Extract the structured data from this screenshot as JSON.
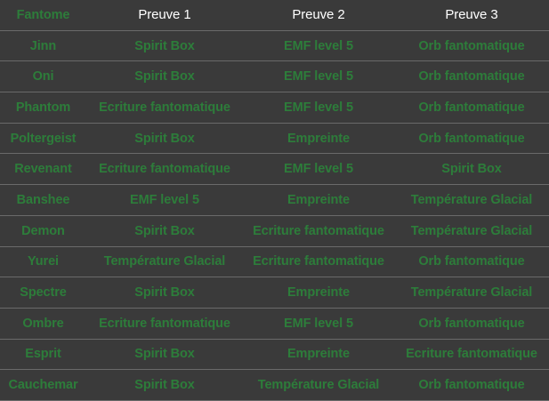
{
  "headers": [
    "Fantome",
    "Preuve   1",
    "Preuve   2",
    "Preuve   3"
  ],
  "rows": [
    [
      "Jinn",
      "Spirit Box",
      "EMF level 5",
      "Orb fantomatique"
    ],
    [
      "Oni",
      "Spirit Box",
      "EMF level 5",
      "Orb fantomatique"
    ],
    [
      "Phantom",
      "Ecriture fantomatique",
      "EMF level 5",
      "Orb fantomatique"
    ],
    [
      "Poltergeist",
      "Spirit Box",
      "Empreinte",
      "Orb fantomatique"
    ],
    [
      "Revenant",
      "Ecriture fantomatique",
      "EMF level 5",
      "Spirit Box"
    ],
    [
      "Banshee",
      "EMF level 5",
      "Empreinte",
      "Température Glacial"
    ],
    [
      "Demon",
      "Spirit Box",
      "Ecriture fantomatique",
      "Température Glacial"
    ],
    [
      "Yurei",
      "Température Glacial",
      "Ecriture fantomatique",
      "Orb fantomatique"
    ],
    [
      "Spectre",
      "Spirit Box",
      "Empreinte",
      "Température Glacial"
    ],
    [
      "Ombre",
      "Ecriture fantomatique",
      "EMF level 5",
      "Orb fantomatique"
    ],
    [
      "Esprit",
      "Spirit Box",
      "Empreinte",
      "Ecriture fantomatique"
    ],
    [
      "Cauchemar",
      "Spirit Box",
      "Température Glacial",
      "Orb fantomatique"
    ]
  ],
  "colors": {
    "background": "#3a3a3a",
    "text_green": "#2d7d3a",
    "header_white": "#ffffff",
    "divider": "#6a6a6a"
  }
}
